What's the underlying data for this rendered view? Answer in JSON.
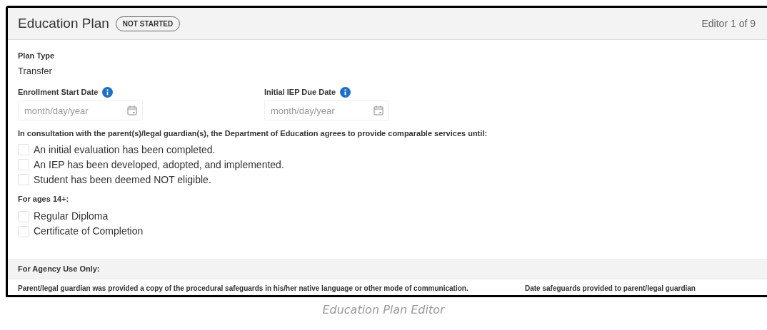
{
  "header": {
    "title": "Education Plan",
    "status": "NOT STARTED",
    "editor_count": "Editor 1 of 9"
  },
  "plan_type": {
    "label": "Plan Type",
    "value": "Transfer"
  },
  "date_fields": [
    {
      "label": "Enrollment Start Date",
      "placeholder": "month/day/year"
    },
    {
      "label": "Initial IEP Due Date",
      "placeholder": "month/day/year"
    }
  ],
  "services": {
    "prompt": "In consultation with the parent(s)/legal guardian(s), the Department of Education agrees to provide comparable services until:",
    "options": [
      {
        "label": "An initial evaluation has been completed.",
        "checked": false
      },
      {
        "label": "An IEP has been developed, adopted, and implemented.",
        "checked": false
      },
      {
        "label": "Student has been deemed NOT eligible.",
        "checked": false
      }
    ]
  },
  "ages": {
    "prompt": "For ages 14+:",
    "options": [
      {
        "label": "Regular Diploma",
        "checked": false
      },
      {
        "label": "Certificate of Completion",
        "checked": false
      }
    ]
  },
  "agency": {
    "title": "For Agency Use Only:",
    "labels": [
      "Parent/legal guardian was provided a copy of the procedural safeguards in his/her native language or other mode of communication.",
      "Date safeguards provided to parent/legal guardian"
    ]
  },
  "caption": "Education Plan Editor"
}
